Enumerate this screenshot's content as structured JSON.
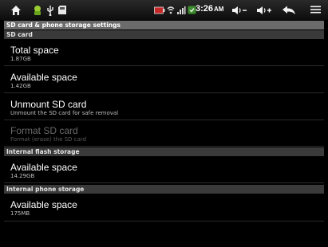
{
  "status_bar": {
    "time": "3:26",
    "ampm": "AM",
    "icons": [
      "home-icon",
      "android-debug-icon",
      "usb-icon",
      "sd-card-icon",
      "battery-icon",
      "wifi-icon",
      "signal-icon",
      "notification-icon",
      "volume-down-icon",
      "volume-up-icon",
      "back-icon",
      "menu-icon"
    ]
  },
  "title": "SD card & phone storage settings",
  "sections": [
    {
      "header": "SD card",
      "items": [
        {
          "title": "Total space",
          "subtitle": "1.87GB",
          "enabled": true
        },
        {
          "title": "Available space",
          "subtitle": "1.42GB",
          "enabled": true
        },
        {
          "title": "Unmount SD card",
          "subtitle": "Unmount the SD card for safe removal",
          "enabled": true
        },
        {
          "title": "Format SD card",
          "subtitle": "Format (erase) the SD card",
          "enabled": false
        }
      ]
    },
    {
      "header": "Internal flash storage",
      "items": [
        {
          "title": "Available space",
          "subtitle": "14.29GB",
          "enabled": true
        }
      ]
    },
    {
      "header": "Internal phone storage",
      "items": [
        {
          "title": "Available space",
          "subtitle": "175MB",
          "enabled": true
        }
      ]
    }
  ]
}
